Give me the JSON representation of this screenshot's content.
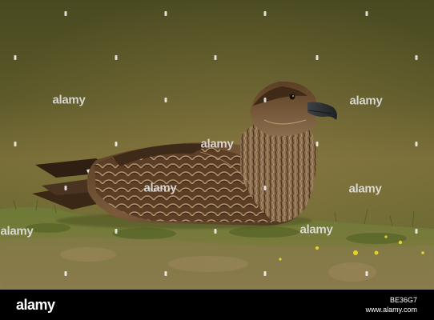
{
  "photo": {
    "subject": "bird-on-grass",
    "colors": {
      "background_top": "#4d4b22",
      "background_mid": "#6f6a36",
      "grass": "#6f7b38",
      "plumage_dark": "#3c2716",
      "plumage_light": "#a98c66",
      "beak": "#2b2d2f",
      "flowers": "#e5d22c"
    }
  },
  "watermark": {
    "text": "alamy",
    "marks": [
      {
        "id": "wm-1",
        "label": "alamy"
      },
      {
        "id": "wm-2",
        "label": "alamy"
      },
      {
        "id": "wm-3",
        "label": "alamy"
      },
      {
        "id": "wm-4",
        "label": "alamy"
      },
      {
        "id": "wm-5",
        "label": "alamy"
      },
      {
        "id": "wm-6",
        "label": "alamy"
      },
      {
        "id": "wm-7",
        "label": "alamy"
      }
    ]
  },
  "footer": {
    "logo": "alamy",
    "image_id": "BE36G7",
    "site": "www.alamy.com"
  }
}
